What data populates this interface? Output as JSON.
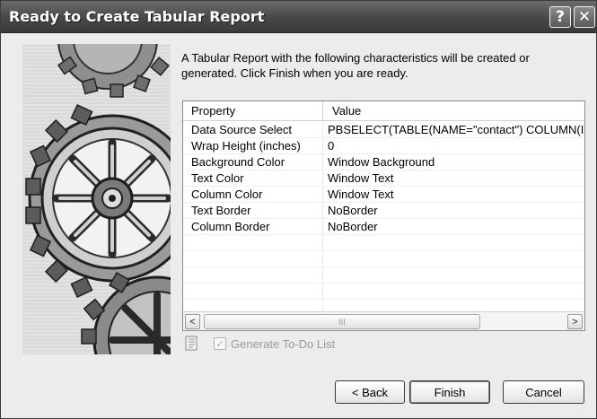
{
  "window": {
    "title": "Ready to Create Tabular Report",
    "help_label": "?",
    "close_label": "✕"
  },
  "intro_text": "A Tabular Report with the following characteristics will be created or generated.  Click Finish when you are ready.",
  "grid": {
    "headers": {
      "property": "Property",
      "value": "Value"
    },
    "rows": [
      {
        "property": "Data Source Select",
        "value": "PBSELECT(TABLE(NAME=\"contact\") COLUMN(I"
      },
      {
        "property": "Wrap Height (inches)",
        "value": "0"
      },
      {
        "property": "Background Color",
        "value": "Window Background"
      },
      {
        "property": "Text Color",
        "value": "Window Text"
      },
      {
        "property": "Column Color",
        "value": "Window Text"
      },
      {
        "property": "Text Border",
        "value": "NoBorder"
      },
      {
        "property": "Column Border",
        "value": "NoBorder"
      }
    ],
    "scroll_left": "<",
    "scroll_right": ">",
    "scroll_thumb_grip": "III"
  },
  "todo": {
    "label": "Generate To-Do List",
    "checked": true,
    "enabled": false
  },
  "buttons": {
    "back": "< Back",
    "finish": "Finish",
    "cancel": "Cancel"
  }
}
